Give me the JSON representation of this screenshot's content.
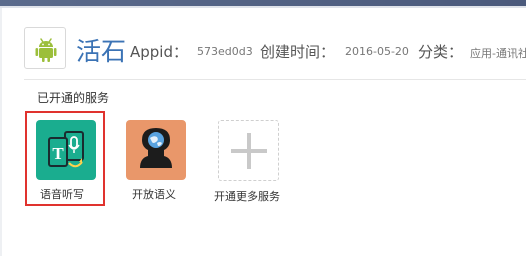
{
  "app": {
    "name": "活石",
    "appid_label": "Appid：",
    "appid_value": "573ed0d3",
    "created_label": "创建时间：",
    "created_value": "2016-05-20",
    "category_label": "分类：",
    "category_value": "应用-通讯社"
  },
  "services": {
    "section_title": "已开通的服务",
    "items": [
      {
        "label": "语音听写",
        "icon": "voice-dictation-icon",
        "color": "#1aad8f",
        "selected": true
      },
      {
        "label": "开放语义",
        "icon": "open-semantics-icon",
        "color": "#e9976a",
        "selected": false
      }
    ],
    "add_label": "开通更多服务"
  },
  "colors": {
    "accent": "#3b73b5",
    "highlight": "#e0322e",
    "android_green": "#9cbf3b"
  }
}
